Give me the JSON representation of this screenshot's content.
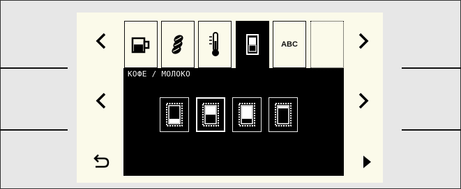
{
  "panel": {
    "title": "КОФЕ / МОЛОКО"
  },
  "tabs": [
    {
      "name": "cup-icon",
      "selected": false
    },
    {
      "name": "coffee-beans-icon",
      "selected": false
    },
    {
      "name": "thermometer-icon",
      "selected": false
    },
    {
      "name": "coffee-milk-ratio-icon",
      "selected": true
    },
    {
      "name": "abc-text-icon",
      "label": "ABC",
      "selected": false
    },
    {
      "name": "empty-slot",
      "selected": false
    }
  ],
  "ratio_options": [
    {
      "coffee_fraction": 0.25,
      "selected": false
    },
    {
      "coffee_fraction": 0.5,
      "selected": true
    },
    {
      "coffee_fraction": 0.75,
      "selected": false
    },
    {
      "coffee_fraction": 0.95,
      "selected": false
    }
  ],
  "icons": {
    "nav_prev_top": "chevron-left-icon",
    "nav_next_top": "chevron-right-icon",
    "nav_prev_mid": "chevron-left-icon",
    "nav_next_mid": "chevron-right-icon",
    "back": "back-arrow-icon",
    "forward": "play-triangle-icon"
  },
  "colors": {
    "screen": "#fbfaea",
    "panel": "#000000",
    "frame": "#e7e7e7"
  }
}
